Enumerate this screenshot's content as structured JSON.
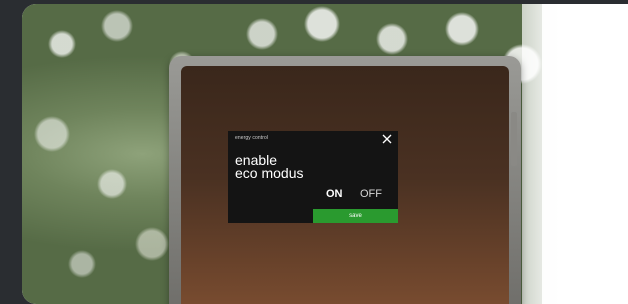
{
  "dialog": {
    "title": "energy control",
    "headline": "enable\neco modus",
    "toggle_on": "ON",
    "toggle_off": "OFF",
    "selected": "ON",
    "save_label": "save"
  },
  "colors": {
    "dialog_background": "#141414",
    "save_accent": "#2a9a2f",
    "page_background": "#2a2d31"
  },
  "icons": {
    "close": "close-icon"
  }
}
